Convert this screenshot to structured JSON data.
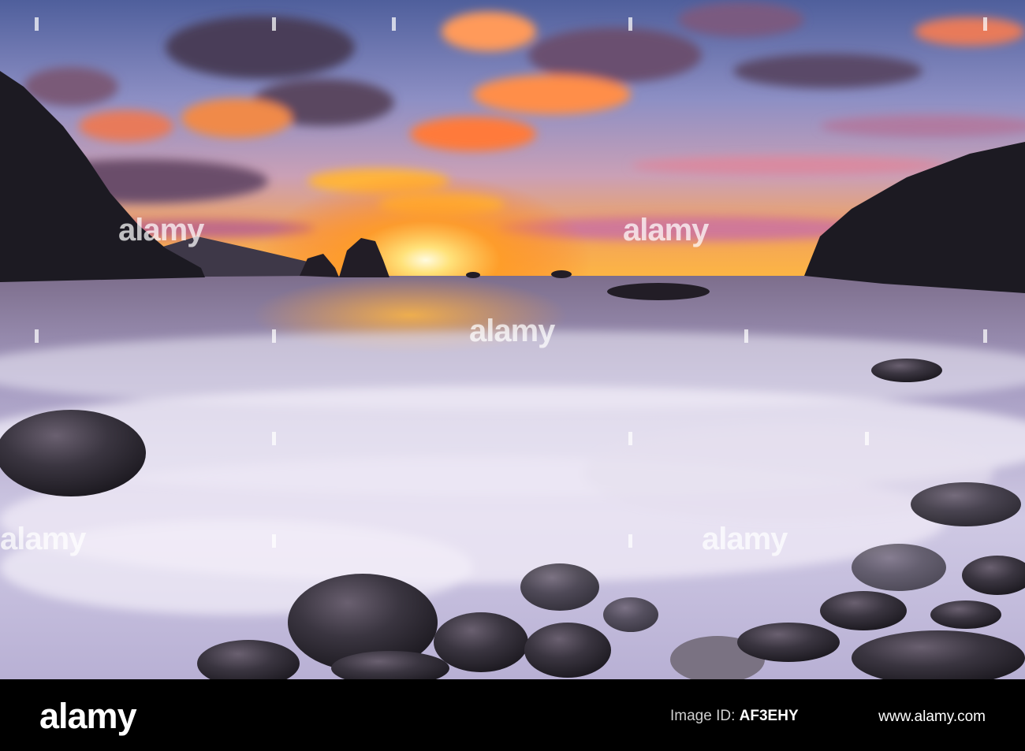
{
  "photo": {
    "watermark_text": "alamy",
    "colors": {
      "sky_top": "#5f6fa8",
      "sky_mid": "#b58bb0",
      "sunset_glow": "#ffa524",
      "sun_core": "#fff6c0",
      "cloud_dark": "#4a3d58",
      "cloud_glow": "#ff8a3c",
      "sea": "#9088b0",
      "surf": "#e6e2f2",
      "rock": "#2a2730",
      "cliff": "#1c1a22"
    }
  },
  "footer": {
    "brand": "alamy",
    "image_id_label": "Image ID:",
    "image_id": "AF3EHY",
    "url": "www.alamy.com"
  }
}
